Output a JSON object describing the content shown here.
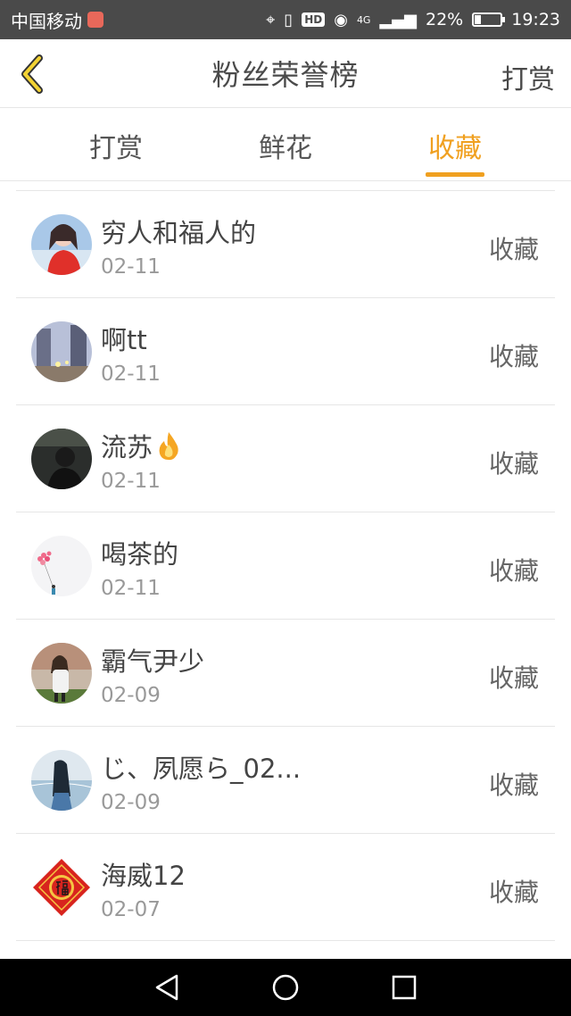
{
  "status_bar": {
    "carrier": "中国移动",
    "hd": "HD",
    "network": "4G",
    "battery_text": "22%",
    "battery_level": 0.22,
    "time": "19:23"
  },
  "header": {
    "title": "粉丝荣誉榜",
    "action_label": "打赏"
  },
  "tabs": [
    {
      "label": "打赏",
      "active": false
    },
    {
      "label": "鲜花",
      "active": false
    },
    {
      "label": "收藏",
      "active": true
    }
  ],
  "accent_color": "#f0a020",
  "fans": [
    {
      "name": "穷人和福人的",
      "date": "02-11",
      "action": "收藏",
      "avatar": "girl-red-avatar"
    },
    {
      "name": "啊tt",
      "date": "02-11",
      "action": "收藏",
      "avatar": "street-avatar"
    },
    {
      "name": "流苏",
      "name_icon": "fire-icon",
      "date": "02-11",
      "action": "收藏",
      "avatar": "dark-portrait-avatar"
    },
    {
      "name": "喝茶的",
      "date": "02-11",
      "action": "收藏",
      "avatar": "balloon-avatar"
    },
    {
      "name": "霸气尹少",
      "date": "02-09",
      "action": "收藏",
      "avatar": "girl-white-avatar"
    },
    {
      "name": "じ、夙愿ら_02...",
      "date": "02-09",
      "action": "收藏",
      "avatar": "girl-sea-avatar"
    },
    {
      "name": "海威12",
      "date": "02-07",
      "action": "收藏",
      "avatar": "fu-character-avatar"
    }
  ]
}
